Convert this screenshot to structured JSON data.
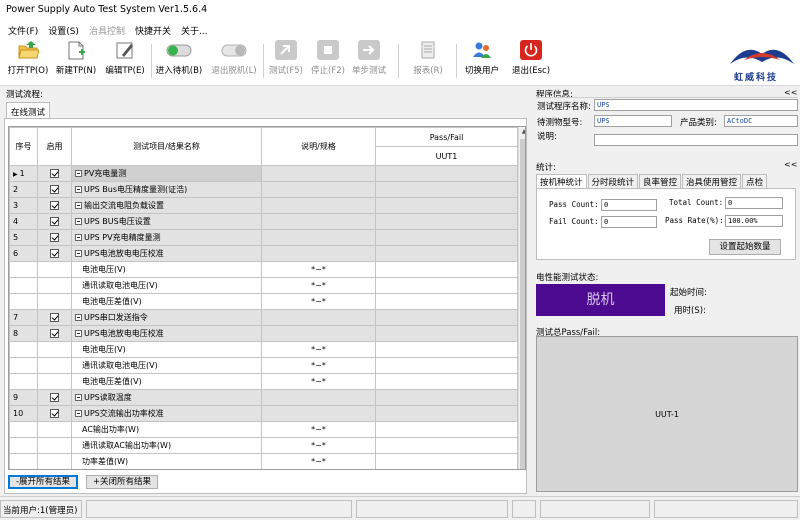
{
  "window": {
    "title": "Power Supply Auto Test System Ver1.5.6.4"
  },
  "menu": [
    {
      "label": "文件(F)",
      "enabled": true
    },
    {
      "label": "设置(S)",
      "enabled": true
    },
    {
      "label": "治具控制",
      "enabled": false
    },
    {
      "label": "快捷开关",
      "enabled": true
    },
    {
      "label": "关于...",
      "enabled": true
    }
  ],
  "toolbar": [
    {
      "label": "打开TP(O)",
      "icon": "open-folder-icon",
      "enabled": true
    },
    {
      "label": "新建TP(N)",
      "icon": "new-file-icon",
      "enabled": true
    },
    {
      "label": "编辑TP(E)",
      "icon": "edit-pen-icon",
      "enabled": true
    },
    {
      "label": "进入待机(B)",
      "icon": "toggle-on-icon",
      "enabled": true
    },
    {
      "label": "退出脱机(L)",
      "icon": "toggle-off-icon",
      "enabled": false
    },
    {
      "label": "测试(F5)",
      "icon": "test-run-icon",
      "enabled": false
    },
    {
      "label": "停止(F2)",
      "icon": "stop-icon",
      "enabled": false
    },
    {
      "label": "单步测试",
      "icon": "step-arrow-icon",
      "enabled": false
    },
    {
      "label": "报表(R)",
      "icon": "report-icon",
      "enabled": false
    },
    {
      "label": "切换用户",
      "icon": "switch-user-icon",
      "enabled": true
    },
    {
      "label": "退出(Esc)",
      "icon": "power-exit-icon",
      "enabled": true
    }
  ],
  "logo": {
    "text": "虹威科技"
  },
  "left": {
    "group_title": "测试流程:",
    "tab": "在线测试",
    "columns": {
      "seq": "序号",
      "enable": "启用",
      "name": "测试项目/结果名称",
      "spec": "说明/规格",
      "passfail": "Pass/Fail",
      "uut": "UUT1"
    },
    "rows": [
      {
        "seq": "1",
        "enabled": true,
        "name": "PV充电量测",
        "group": true,
        "current": true,
        "spec": ""
      },
      {
        "seq": "2",
        "enabled": true,
        "name": "UPS Bus电压精度量测(证浩)",
        "group": true,
        "spec": ""
      },
      {
        "seq": "3",
        "enabled": true,
        "name": "输出交流电阻负载设置",
        "group": true,
        "spec": ""
      },
      {
        "seq": "4",
        "enabled": true,
        "name": "UPS BUS电压设置",
        "group": true,
        "spec": ""
      },
      {
        "seq": "5",
        "enabled": true,
        "name": "UPS PV充电精度量测",
        "group": true,
        "spec": ""
      },
      {
        "seq": "6",
        "enabled": true,
        "name": "UPS电池放电电压校准",
        "group": true,
        "spec": ""
      },
      {
        "seq": "",
        "enabled": false,
        "name": "电池电压(V)",
        "group": false,
        "spec": "*~*"
      },
      {
        "seq": "",
        "enabled": false,
        "name": "通讯读取电池电压(V)",
        "group": false,
        "spec": "*~*"
      },
      {
        "seq": "",
        "enabled": false,
        "name": "电池电压差值(V)",
        "group": false,
        "spec": "*~*"
      },
      {
        "seq": "7",
        "enabled": true,
        "name": "UPS串口发送指令",
        "group": true,
        "spec": ""
      },
      {
        "seq": "8",
        "enabled": true,
        "name": "UPS电池放电电压校准",
        "group": true,
        "spec": ""
      },
      {
        "seq": "",
        "enabled": false,
        "name": "电池电压(V)",
        "group": false,
        "spec": "*~*"
      },
      {
        "seq": "",
        "enabled": false,
        "name": "通讯读取电池电压(V)",
        "group": false,
        "spec": "*~*"
      },
      {
        "seq": "",
        "enabled": false,
        "name": "电池电压差值(V)",
        "group": false,
        "spec": "*~*"
      },
      {
        "seq": "9",
        "enabled": true,
        "name": "UPS读取温度",
        "group": true,
        "spec": ""
      },
      {
        "seq": "10",
        "enabled": true,
        "name": "UPS交流输出功率校准",
        "group": true,
        "spec": ""
      },
      {
        "seq": "",
        "enabled": false,
        "name": "AC输出功率(W)",
        "group": false,
        "spec": "*~*"
      },
      {
        "seq": "",
        "enabled": false,
        "name": "通讯读取AC输出功率(W)",
        "group": false,
        "spec": "*~*"
      },
      {
        "seq": "",
        "enabled": false,
        "name": "功率差值(W)",
        "group": false,
        "spec": "*~*"
      }
    ],
    "expand_btn": "-展开所有结果",
    "collapse_btn": "+关闭所有结果"
  },
  "right": {
    "program_info": {
      "title": "程序信息:",
      "name_label": "测试程序名称:",
      "name_value": "UPS",
      "dut_label": "待测物型号:",
      "dut_value": "UPS",
      "category_label": "产品类别:",
      "category_value": "ACtoDC",
      "desc_label": "说明:",
      "desc_value": ""
    },
    "stats": {
      "title": "统计:",
      "tabs": [
        "按机种统计",
        "分时段统计",
        "良率管控",
        "治具使用管控",
        "点检"
      ],
      "pass_label": "Pass Count:",
      "pass_value": "0",
      "fail_label": "Fail Count:",
      "fail_value": "0",
      "total_label": "Total Count:",
      "total_value": "0",
      "rate_label": "Pass Rate(%):",
      "rate_value": "100.00%",
      "set_btn": "设置起始数量"
    },
    "electrical": {
      "title": "电性能测试状态:",
      "status": "脱机",
      "start_label": "起始时间:",
      "elapsed_label": "用时(S):"
    },
    "total_pf": {
      "title": "测试总Pass/Fail:",
      "uut": "UUT-1"
    },
    "collapse_glyph": "<<",
    "status_color": "#4b0a8f"
  },
  "statusbar": {
    "user": "当前用户:1(管理员)"
  }
}
